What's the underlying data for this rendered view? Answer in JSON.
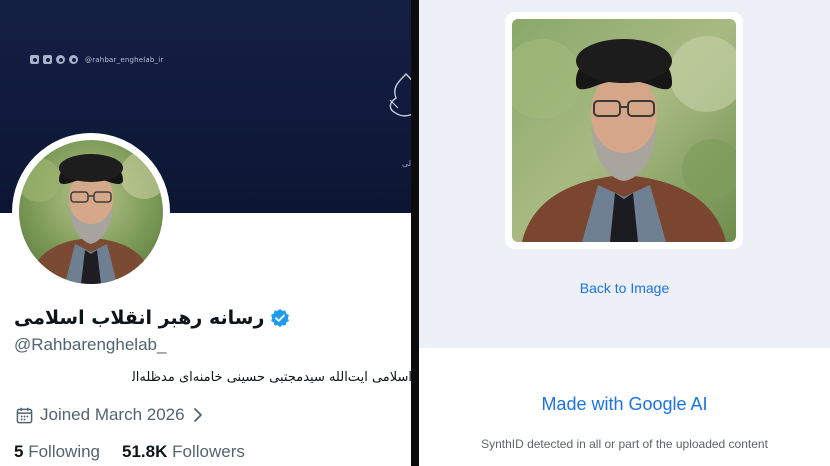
{
  "profile": {
    "banner": {
      "social_handle": "@rahbar_enghelab_ir",
      "arabic_fragment_line1": "بی",
      "arabic_fragment_line2": "العالی",
      "background_color": "#141f44"
    },
    "display_name": "رسانه رهبر انقلاب اسلامی",
    "verified": true,
    "handle": "@Rahbarenghelab_",
    "bio": "اسلامی آیت‌الله سیدمجتبی حسینی خامنه‌ای مدظله‌العالی",
    "joined": "Joined March 2026",
    "following_count": "5",
    "following_label": "Following",
    "followers_count": "51.8K",
    "followers_label": "Followers",
    "icons": [
      "instagram-icon",
      "social-icon",
      "telegram-icon",
      "send-icon",
      "verified-badge-icon",
      "calendar-icon",
      "chevron-right-icon"
    ]
  },
  "synthid": {
    "back_link": "Back to Image",
    "result_title": "Made with Google AI",
    "result_detail": "SynthID detected in all or part of the uploaded content",
    "accent_color": "#1a73e8"
  }
}
